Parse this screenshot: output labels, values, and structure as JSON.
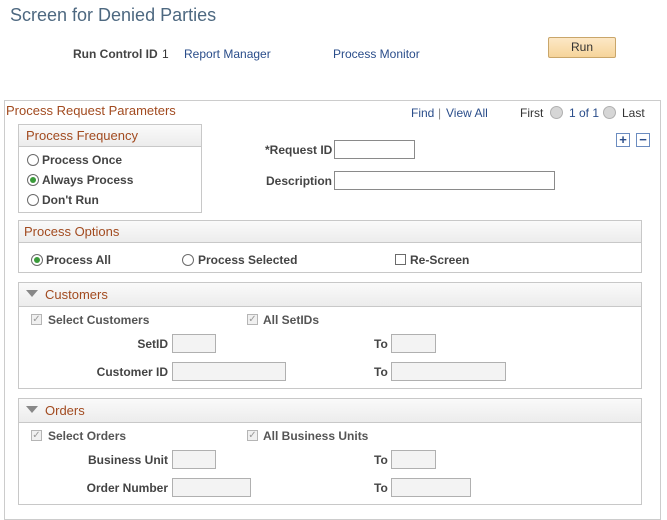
{
  "page": {
    "title": "Screen for Denied Parties"
  },
  "toolbar": {
    "run_control_label": "Run Control ID",
    "run_control_value": "1",
    "report_manager": "Report Manager",
    "process_monitor": "Process Monitor",
    "run_label": "Run"
  },
  "params": {
    "title": "Process Request Parameters",
    "find": "Find",
    "separator": "|",
    "view_all": "View All",
    "first": "First",
    "paging": "1 of 1",
    "last": "Last",
    "add": "+",
    "remove": "−"
  },
  "frequency": {
    "title": "Process Frequency",
    "options": [
      "Process Once",
      "Always Process",
      "Don't Run"
    ],
    "selected": "Always Process"
  },
  "request": {
    "request_id_label": "*Request ID",
    "request_id_value": "",
    "description_label": "Description",
    "description_value": ""
  },
  "options": {
    "title": "Process Options",
    "process_all": "Process All",
    "process_selected": "Process Selected",
    "rescreen": "Re-Screen",
    "selected": "Process All"
  },
  "customers": {
    "title": "Customers",
    "select_label": "Select Customers",
    "all_setids_label": "All SetIDs",
    "setid_label": "SetID",
    "to_label": "To",
    "customer_id_label": "Customer ID"
  },
  "orders": {
    "title": "Orders",
    "select_label": "Select Orders",
    "all_bu_label": "All Business Units",
    "bu_label": "Business Unit",
    "to_label": "To",
    "order_number_label": "Order Number"
  },
  "colors": {
    "accent": "#a24b20",
    "link": "#2a4d8a",
    "title": "#4d6880",
    "radio_on": "#3a9b3a"
  }
}
